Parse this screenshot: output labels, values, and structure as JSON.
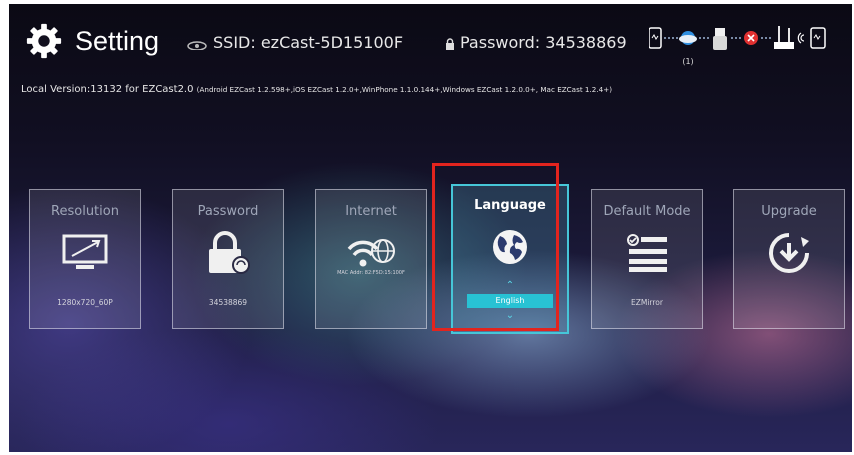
{
  "header": {
    "title": "Setting",
    "ssid_text": "SSID: ezCast-5D15100F",
    "password_text": "Password: 34538869",
    "connection_count": "(1)",
    "version_main": "Local Version:13132 for EZCast2.0",
    "version_clients": "(Android EZCast 1.2.598+,iOS EZCast 1.2.0+,WinPhone 1.1.0.144+,Windows EZCast 1.2.0.0+, Mac EZCast 1.2.4+)"
  },
  "tiles": [
    {
      "label": "Resolution",
      "value": "1280x720_60P",
      "icon": "monitor-icon"
    },
    {
      "label": "Password",
      "value": "34538869",
      "icon": "lock-icon"
    },
    {
      "label": "Internet",
      "value": "MAC Addr: 82:F5D:15:100F",
      "icon": "wifi-globe-icon"
    },
    {
      "label": "Language",
      "value": "English",
      "icon": "globe-icon"
    },
    {
      "label": "Default Mode",
      "value": "EZMirror",
      "icon": "list-check-icon"
    },
    {
      "label": "Upgrade",
      "value": "",
      "icon": "upgrade-icon"
    }
  ],
  "colors": {
    "accent": "#28c2d4",
    "highlight_frame": "#e2241e",
    "disconnected": "#e03030",
    "connected": "#2f8fe0"
  }
}
